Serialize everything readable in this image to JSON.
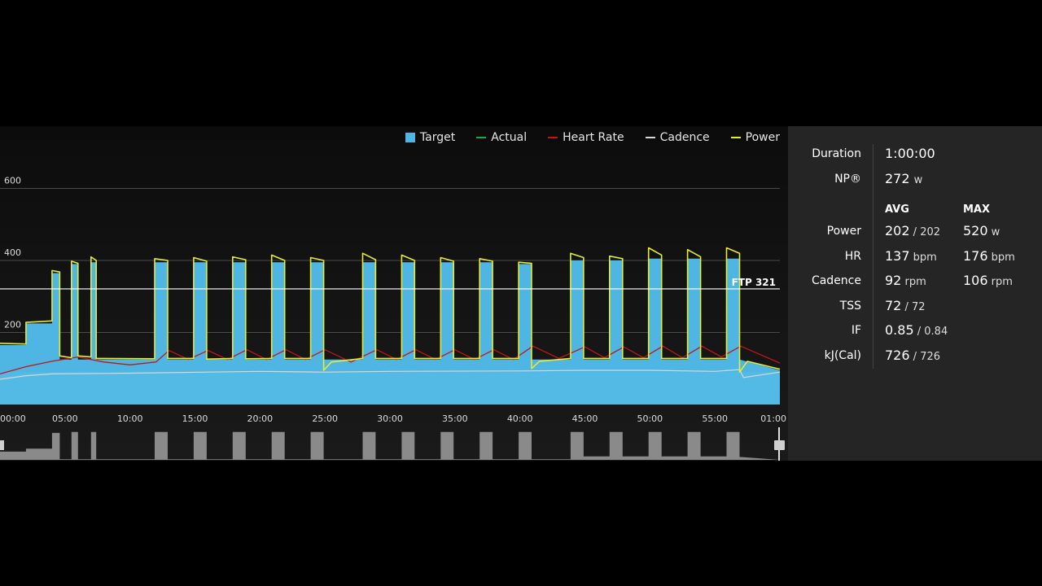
{
  "colors": {
    "target": "#4fb6e3",
    "actual": "#1fa64a",
    "heart_rate": "#c01515",
    "cadence": "#d8d8d8",
    "power": "#e4ec33",
    "ftp_line": "#ffffff",
    "panel_bg": "#252525",
    "segments": "#8a8a8a"
  },
  "legend": [
    {
      "label": "Target",
      "kind": "box",
      "color": "#4fb6e3"
    },
    {
      "label": "Actual",
      "kind": "line",
      "color": "#1fa64a"
    },
    {
      "label": "Heart Rate",
      "kind": "line",
      "color": "#c01515"
    },
    {
      "label": "Cadence",
      "kind": "line",
      "color": "#d8d8d8"
    },
    {
      "label": "Power",
      "kind": "line",
      "color": "#e4ec33"
    }
  ],
  "chart_data": {
    "type": "area",
    "xlabel": "",
    "ylabel": "",
    "xlim": [
      0,
      60
    ],
    "ylim": [
      0,
      650
    ],
    "y_ticks": [
      200,
      400,
      600
    ],
    "x_ticks": [
      "00:00",
      "05:00",
      "10:00",
      "15:00",
      "20:00",
      "25:00",
      "30:00",
      "35:00",
      "40:00",
      "45:00",
      "50:00",
      "55:00",
      "01:00"
    ],
    "grid": true,
    "legend_position": "top-right",
    "ftp": {
      "label": "FTP 321",
      "value": 321
    },
    "base_watts": 125,
    "series": [
      {
        "name": "Target",
        "unit": "W",
        "points": [
          [
            0,
            165
          ],
          [
            2,
            165
          ],
          [
            2,
            225
          ],
          [
            4,
            225
          ],
          [
            4,
            365
          ],
          [
            4.6,
            365
          ],
          [
            4.6,
            125
          ],
          [
            5.5,
            125
          ],
          [
            5.5,
            390
          ],
          [
            6,
            390
          ],
          [
            6,
            125
          ],
          [
            7,
            125
          ],
          [
            7,
            395
          ],
          [
            7.4,
            395
          ],
          [
            7.4,
            125
          ],
          [
            11.9,
            125
          ],
          [
            11.9,
            395
          ],
          [
            12.9,
            395
          ],
          [
            12.9,
            125
          ],
          [
            14.9,
            125
          ],
          [
            14.9,
            395
          ],
          [
            15.9,
            395
          ],
          [
            15.9,
            125
          ],
          [
            17.9,
            125
          ],
          [
            17.9,
            395
          ],
          [
            18.9,
            395
          ],
          [
            18.9,
            125
          ],
          [
            20.9,
            125
          ],
          [
            20.9,
            395
          ],
          [
            21.9,
            395
          ],
          [
            21.9,
            125
          ],
          [
            23.9,
            125
          ],
          [
            23.9,
            395
          ],
          [
            24.9,
            395
          ],
          [
            24.9,
            125
          ],
          [
            27.9,
            125
          ],
          [
            27.9,
            395
          ],
          [
            28.9,
            395
          ],
          [
            28.9,
            125
          ],
          [
            30.9,
            125
          ],
          [
            30.9,
            395
          ],
          [
            31.9,
            395
          ],
          [
            31.9,
            125
          ],
          [
            33.9,
            125
          ],
          [
            33.9,
            395
          ],
          [
            34.9,
            395
          ],
          [
            34.9,
            125
          ],
          [
            36.9,
            125
          ],
          [
            36.9,
            395
          ],
          [
            37.9,
            395
          ],
          [
            37.9,
            125
          ],
          [
            39.9,
            125
          ],
          [
            39.9,
            390
          ],
          [
            40.9,
            390
          ],
          [
            40.9,
            125
          ],
          [
            43.9,
            125
          ],
          [
            43.9,
            400
          ],
          [
            44.9,
            400
          ],
          [
            44.9,
            125
          ],
          [
            46.9,
            125
          ],
          [
            46.9,
            400
          ],
          [
            47.9,
            400
          ],
          [
            47.9,
            125
          ],
          [
            49.9,
            125
          ],
          [
            49.9,
            405
          ],
          [
            50.9,
            405
          ],
          [
            50.9,
            125
          ],
          [
            52.9,
            125
          ],
          [
            52.9,
            405
          ],
          [
            53.9,
            405
          ],
          [
            53.9,
            125
          ],
          [
            55.9,
            125
          ],
          [
            55.9,
            405
          ],
          [
            56.9,
            405
          ],
          [
            56.9,
            125
          ],
          [
            60,
            95
          ]
        ]
      },
      {
        "name": "Power",
        "unit": "W",
        "points": [
          [
            0,
            170
          ],
          [
            2,
            168
          ],
          [
            2,
            228
          ],
          [
            4,
            232
          ],
          [
            4,
            372
          ],
          [
            4.6,
            368
          ],
          [
            4.6,
            135
          ],
          [
            5.5,
            130
          ],
          [
            5.5,
            398
          ],
          [
            6,
            392
          ],
          [
            6,
            135
          ],
          [
            7,
            132
          ],
          [
            7,
            410
          ],
          [
            7.4,
            400
          ],
          [
            7.4,
            128
          ],
          [
            11.9,
            127
          ],
          [
            11.9,
            405
          ],
          [
            12.9,
            400
          ],
          [
            12.9,
            128
          ],
          [
            14.9,
            128
          ],
          [
            14.9,
            408
          ],
          [
            15.9,
            398
          ],
          [
            15.9,
            126
          ],
          [
            17.9,
            128
          ],
          [
            17.9,
            410
          ],
          [
            18.9,
            402
          ],
          [
            18.9,
            127
          ],
          [
            20.9,
            128
          ],
          [
            20.9,
            415
          ],
          [
            21.9,
            400
          ],
          [
            21.9,
            128
          ],
          [
            23.9,
            128
          ],
          [
            23.9,
            408
          ],
          [
            24.9,
            400
          ],
          [
            24.9,
            95
          ],
          [
            25.5,
            118
          ],
          [
            27.9,
            128
          ],
          [
            27.9,
            420
          ],
          [
            28.9,
            402
          ],
          [
            28.9,
            128
          ],
          [
            30.9,
            128
          ],
          [
            30.9,
            415
          ],
          [
            31.9,
            400
          ],
          [
            31.9,
            128
          ],
          [
            33.9,
            128
          ],
          [
            33.9,
            408
          ],
          [
            34.9,
            398
          ],
          [
            34.9,
            128
          ],
          [
            36.9,
            128
          ],
          [
            36.9,
            405
          ],
          [
            37.9,
            398
          ],
          [
            37.9,
            128
          ],
          [
            39.9,
            128
          ],
          [
            39.9,
            395
          ],
          [
            40.9,
            392
          ],
          [
            40.9,
            100
          ],
          [
            41.5,
            120
          ],
          [
            43.9,
            128
          ],
          [
            43.9,
            420
          ],
          [
            44.9,
            408
          ],
          [
            44.9,
            128
          ],
          [
            46.9,
            128
          ],
          [
            46.9,
            412
          ],
          [
            47.9,
            405
          ],
          [
            47.9,
            128
          ],
          [
            49.9,
            128
          ],
          [
            49.9,
            435
          ],
          [
            50.9,
            415
          ],
          [
            50.9,
            128
          ],
          [
            52.9,
            128
          ],
          [
            52.9,
            430
          ],
          [
            53.9,
            410
          ],
          [
            53.9,
            128
          ],
          [
            55.9,
            128
          ],
          [
            55.9,
            435
          ],
          [
            56.9,
            420
          ],
          [
            56.9,
            90
          ],
          [
            57.5,
            120
          ],
          [
            60,
            98
          ]
        ]
      },
      {
        "name": "Heart Rate",
        "unit": "bpm",
        "points": [
          [
            0,
            85
          ],
          [
            2,
            105
          ],
          [
            4,
            120
          ],
          [
            6,
            132
          ],
          [
            8,
            118
          ],
          [
            10,
            110
          ],
          [
            12,
            118
          ],
          [
            13,
            150
          ],
          [
            14.5,
            125
          ],
          [
            16,
            150
          ],
          [
            17.5,
            125
          ],
          [
            19,
            152
          ],
          [
            20.5,
            125
          ],
          [
            22,
            152
          ],
          [
            23.5,
            125
          ],
          [
            25,
            152
          ],
          [
            27,
            118
          ],
          [
            29,
            152
          ],
          [
            30.5,
            125
          ],
          [
            32,
            152
          ],
          [
            33.5,
            125
          ],
          [
            35,
            152
          ],
          [
            36.5,
            125
          ],
          [
            38,
            152
          ],
          [
            39.5,
            125
          ],
          [
            41,
            162
          ],
          [
            43,
            128
          ],
          [
            45,
            160
          ],
          [
            46.5,
            130
          ],
          [
            48,
            160
          ],
          [
            49.5,
            130
          ],
          [
            51,
            162
          ],
          [
            52.5,
            130
          ],
          [
            54,
            162
          ],
          [
            55.5,
            132
          ],
          [
            57,
            162
          ],
          [
            60,
            115
          ]
        ]
      },
      {
        "name": "Cadence",
        "unit": "rpm",
        "points": [
          [
            0,
            70
          ],
          [
            2,
            80
          ],
          [
            4,
            85
          ],
          [
            10,
            87
          ],
          [
            20,
            92
          ],
          [
            25,
            90
          ],
          [
            30,
            92
          ],
          [
            40,
            93
          ],
          [
            45,
            95
          ],
          [
            50,
            95
          ],
          [
            55,
            92
          ],
          [
            56.9,
            97
          ],
          [
            57.2,
            75
          ],
          [
            60,
            90
          ]
        ]
      }
    ]
  },
  "segments_strip": [
    [
      0,
      0.28
    ],
    [
      2,
      0.28
    ],
    [
      2,
      0.38
    ],
    [
      4,
      0.38
    ],
    [
      4,
      0.92
    ],
    [
      4.6,
      0.92
    ],
    [
      4.6,
      0.02
    ],
    [
      5.5,
      0.02
    ],
    [
      5.5,
      0.95
    ],
    [
      6,
      0.95
    ],
    [
      6,
      0.02
    ],
    [
      7,
      0.02
    ],
    [
      7,
      0.95
    ],
    [
      7.4,
      0.95
    ],
    [
      7.4,
      0.02
    ],
    [
      11.9,
      0.02
    ],
    [
      11.9,
      0.95
    ],
    [
      12.9,
      0.95
    ],
    [
      12.9,
      0.02
    ],
    [
      14.9,
      0.02
    ],
    [
      14.9,
      0.95
    ],
    [
      15.9,
      0.95
    ],
    [
      15.9,
      0.02
    ],
    [
      17.9,
      0.02
    ],
    [
      17.9,
      0.95
    ],
    [
      18.9,
      0.95
    ],
    [
      18.9,
      0.02
    ],
    [
      20.9,
      0.02
    ],
    [
      20.9,
      0.95
    ],
    [
      21.9,
      0.95
    ],
    [
      21.9,
      0.02
    ],
    [
      23.9,
      0.02
    ],
    [
      23.9,
      0.95
    ],
    [
      24.9,
      0.95
    ],
    [
      24.9,
      0.02
    ],
    [
      27.9,
      0.02
    ],
    [
      27.9,
      0.95
    ],
    [
      28.9,
      0.95
    ],
    [
      28.9,
      0.02
    ],
    [
      30.9,
      0.02
    ],
    [
      30.9,
      0.95
    ],
    [
      31.9,
      0.95
    ],
    [
      31.9,
      0.02
    ],
    [
      33.9,
      0.02
    ],
    [
      33.9,
      0.95
    ],
    [
      34.9,
      0.95
    ],
    [
      34.9,
      0.02
    ],
    [
      36.9,
      0.02
    ],
    [
      36.9,
      0.95
    ],
    [
      37.9,
      0.95
    ],
    [
      37.9,
      0.02
    ],
    [
      39.9,
      0.02
    ],
    [
      39.9,
      0.95
    ],
    [
      40.9,
      0.95
    ],
    [
      40.9,
      0.02
    ],
    [
      43.9,
      0.02
    ],
    [
      43.9,
      0.95
    ],
    [
      44.9,
      0.95
    ],
    [
      44.9,
      0.12
    ],
    [
      46.9,
      0.12
    ],
    [
      46.9,
      0.95
    ],
    [
      47.9,
      0.95
    ],
    [
      47.9,
      0.12
    ],
    [
      49.9,
      0.12
    ],
    [
      49.9,
      0.95
    ],
    [
      50.9,
      0.95
    ],
    [
      50.9,
      0.12
    ],
    [
      52.9,
      0.12
    ],
    [
      52.9,
      0.95
    ],
    [
      53.9,
      0.95
    ],
    [
      53.9,
      0.12
    ],
    [
      55.9,
      0.12
    ],
    [
      55.9,
      0.95
    ],
    [
      56.9,
      0.95
    ],
    [
      56.9,
      0.1
    ],
    [
      60,
      0
    ]
  ],
  "stats": {
    "duration_label": "Duration",
    "duration_value": "1:00:00",
    "np_label": "NP®",
    "np_value": "272",
    "np_unit": "w",
    "avg_header": "AVG",
    "max_header": "MAX",
    "rows": [
      {
        "label": "Power",
        "avg": "202",
        "avg_sub": " / 202",
        "max": "520",
        "max_unit": " w"
      },
      {
        "label": "HR",
        "avg": "137",
        "avg_sub": " bpm",
        "max": "176",
        "max_unit": " bpm"
      },
      {
        "label": "Cadence",
        "avg": "92",
        "avg_sub": " rpm",
        "max": "106",
        "max_unit": " rpm"
      },
      {
        "label": "TSS",
        "avg": "72",
        "avg_sub": " / 72",
        "max": "",
        "max_unit": ""
      },
      {
        "label": "IF",
        "avg": "0.85",
        "avg_sub": " / 0.84",
        "max": "",
        "max_unit": ""
      },
      {
        "label": "kJ(Cal)",
        "avg": "726",
        "avg_sub": " / 726",
        "max": "",
        "max_unit": ""
      }
    ]
  }
}
